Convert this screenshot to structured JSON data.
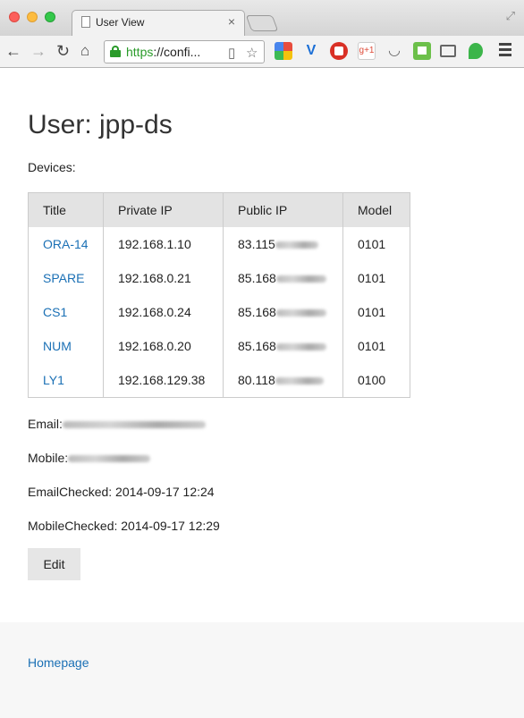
{
  "browser": {
    "tab_title": "User View",
    "tab_close": "×",
    "url_scheme": "https",
    "url_rest": "://confi...",
    "ext_gplus": "g+1"
  },
  "page": {
    "title": "User: jpp-ds",
    "devices_label": "Devices:",
    "table": {
      "headers": [
        "Title",
        "Private IP",
        "Public IP",
        "Model"
      ],
      "rows": [
        {
          "title": "ORA-14",
          "private_ip": "192.168.1.10",
          "public_ip_visible": "83.115",
          "model": "0101"
        },
        {
          "title": "SPARE",
          "private_ip": "192.168.0.21",
          "public_ip_visible": "85.168",
          "model": "0101"
        },
        {
          "title": "CS1",
          "private_ip": "192.168.0.24",
          "public_ip_visible": "85.168",
          "model": "0101"
        },
        {
          "title": "NUM",
          "private_ip": "192.168.0.20",
          "public_ip_visible": "85.168",
          "model": "0101"
        },
        {
          "title": "LY1",
          "private_ip": "192.168.129.38",
          "public_ip_visible": "80.118",
          "model": "0100"
        }
      ]
    },
    "email_label": "Email:",
    "mobile_label": "Mobile:",
    "email_checked": "EmailChecked: 2014-09-17 12:24",
    "mobile_checked": "MobileChecked: 2014-09-17 12:29",
    "edit_label": "Edit"
  },
  "footer": {
    "homepage_link": "Homepage"
  },
  "colors": {
    "link": "#1b70b5",
    "header_bg": "#e3e3e3",
    "secure_green": "#2a9b2a"
  }
}
